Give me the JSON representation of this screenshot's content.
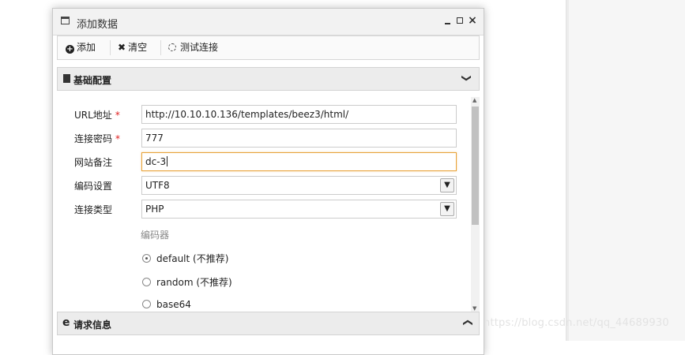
{
  "window": {
    "title": "添加数据",
    "controls": {
      "minimize": "minimize-icon",
      "maximize": "maximize-icon",
      "close": "×"
    }
  },
  "toolbar": {
    "add_label": "添加",
    "clear_label": "清空",
    "test_label": "测试连接"
  },
  "sections": {
    "basic_title": "基础配置",
    "request_title": "请求信息",
    "basic_chevron": "❯",
    "request_chevron": "❯"
  },
  "form": {
    "url": {
      "label": "URL地址",
      "required": "*",
      "value": "http://10.10.10.136/templates/beez3/html/"
    },
    "password": {
      "label": "连接密码",
      "required": "*",
      "value": "777"
    },
    "note": {
      "label": "网站备注",
      "value": "dc-3"
    },
    "encoding": {
      "label": "编码设置",
      "value": "UTF8"
    },
    "type": {
      "label": "连接类型",
      "value": "PHP"
    },
    "encoder": {
      "label": "编码器",
      "options": [
        {
          "label": "default (不推荐)",
          "checked": true
        },
        {
          "label": "random (不推荐)",
          "checked": false
        },
        {
          "label": "base64",
          "checked": false
        }
      ]
    }
  },
  "watermark": "https://blog.csdn.net/qq_44689930"
}
